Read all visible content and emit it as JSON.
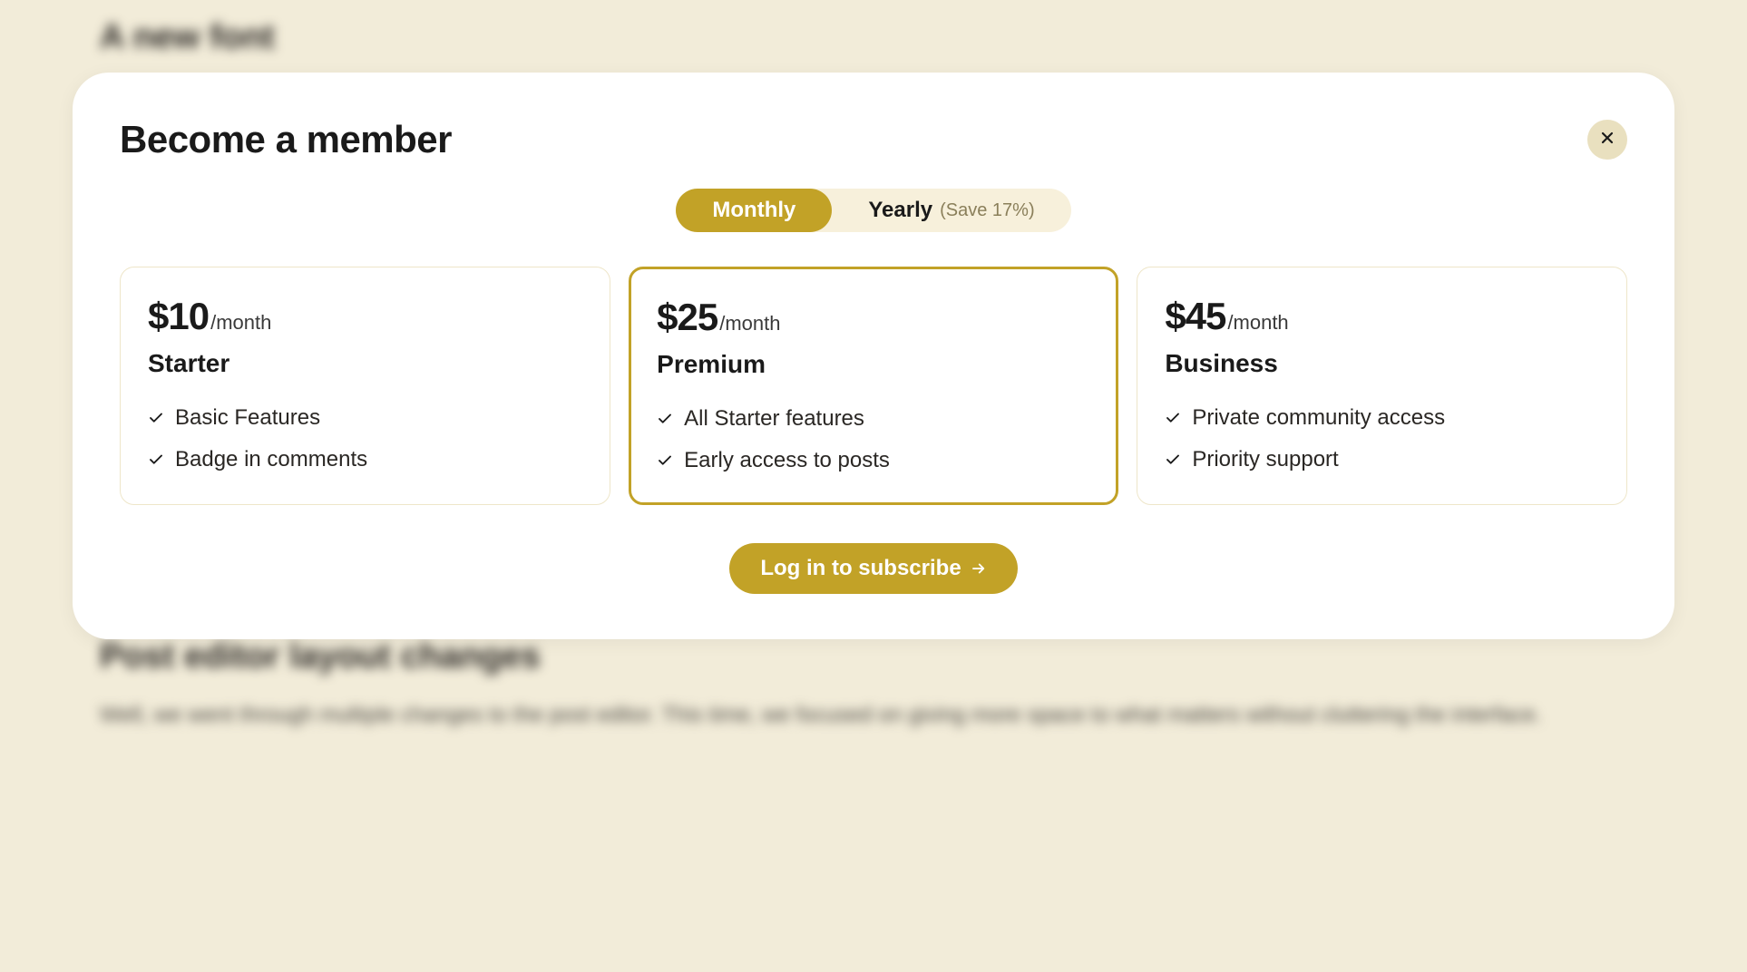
{
  "background": {
    "heading1": "A new font",
    "heading2": "Post editor layout changes",
    "para": "Well, we went through multiple changes to the post editor. This time, we focused on giving more space to what matters without cluttering the interface."
  },
  "modal": {
    "title": "Become a member",
    "toggle": {
      "monthly": "Monthly",
      "yearly": "Yearly",
      "yearly_note": "(Save 17%)"
    },
    "plans": [
      {
        "price": "$10",
        "period": "/month",
        "name": "Starter",
        "features": [
          "Basic Features",
          "Badge in comments"
        ],
        "selected": false
      },
      {
        "price": "$25",
        "period": "/month",
        "name": "Premium",
        "features": [
          "All Starter features",
          "Early access to posts"
        ],
        "selected": true
      },
      {
        "price": "$45",
        "period": "/month",
        "name": "Business",
        "features": [
          "Private community access",
          "Priority support"
        ],
        "selected": false
      }
    ],
    "cta": "Log in to subscribe"
  }
}
